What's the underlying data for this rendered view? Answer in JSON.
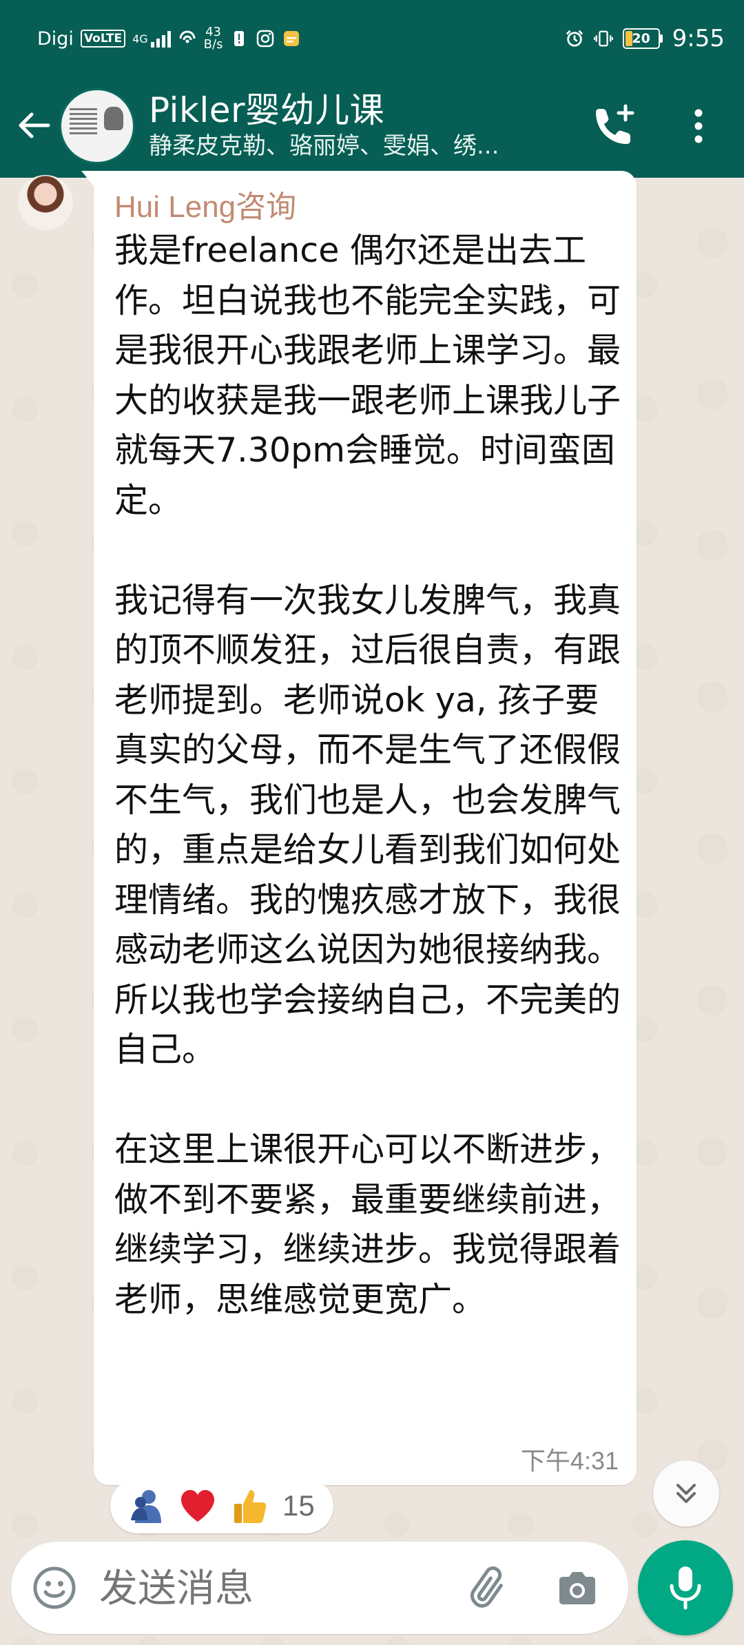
{
  "status_bar": {
    "carrier": "Digi",
    "volte": "VoLTE",
    "network": "4G",
    "speed_value": "43",
    "speed_unit": "B/s",
    "battery_level": "20",
    "battery_fraction": 0.2,
    "time": "9:55"
  },
  "header": {
    "title": "Pikler婴幼儿课",
    "subtitle": "静柔皮克勒、骆丽婷、雯娟、绣..."
  },
  "message": {
    "sender": "Hui Leng咨询",
    "body": "我是freelance 偶尔还是出去工作。坦白说我也不能完全实践，可是我很开心我跟老师上课学习。最大的收获是我一跟老师上课我儿子就每天7.30pm会睡觉。时间蛮固定。\n\n我记得有一次我女儿发脾气，我真的顶不顺发狂，过后很自责，有跟老师提到。老师说ok ya, 孩子要真实的父母，而不是生气了还假假不生气，我们也是人，也会发脾气的，重点是给女儿看到我们如何处理情绪。我的愧疚感才放下，我很感动老师这么说因为她很接纳我。所以我也学会接纳自己，不完美的自己。\n\n在这里上课很开心可以不断进步，做不到不要紧，最重要继续前进，继续学习，继续进步。我觉得跟着老师，思维感觉更宽广。",
    "time": "下午4:31"
  },
  "reactions": {
    "emojis": [
      "hugging-person-icon",
      "heart-icon",
      "thumbs-up-icon"
    ],
    "count": "15"
  },
  "composer": {
    "placeholder": "发送消息"
  },
  "colors": {
    "header": "#075E54",
    "accent": "#00A884",
    "sender_name": "#C28A72",
    "wallpaper": "#ECE5DD"
  }
}
